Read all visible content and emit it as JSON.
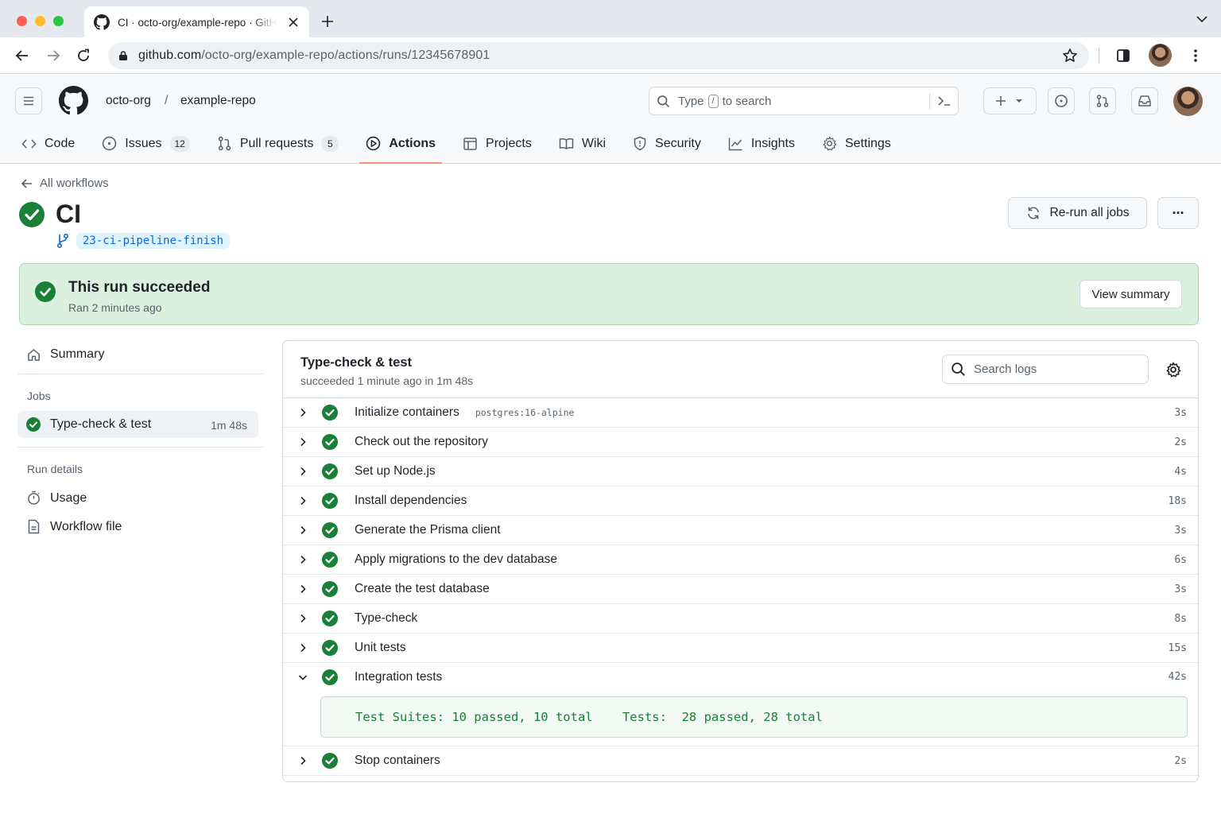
{
  "browser": {
    "tab_title": "CI · octo-org/example-repo · GitHub",
    "url_host": "github.com",
    "url_path": "/octo-org/example-repo/actions/runs/12345678901"
  },
  "header": {
    "owner": "octo-org",
    "separator": "/",
    "repo": "example-repo",
    "search": {
      "prefix": "Type",
      "key": "/",
      "suffix": "to search"
    }
  },
  "nav": [
    {
      "label": "Code",
      "count": null
    },
    {
      "label": "Issues",
      "count": "12"
    },
    {
      "label": "Pull requests",
      "count": "5"
    },
    {
      "label": "Actions",
      "count": null,
      "active": true
    },
    {
      "label": "Projects",
      "count": null
    },
    {
      "label": "Wiki",
      "count": null
    },
    {
      "label": "Security",
      "count": null
    },
    {
      "label": "Insights",
      "count": null
    },
    {
      "label": "Settings",
      "count": null
    }
  ],
  "run": {
    "back_label": "All workflows",
    "workflow_name": "CI",
    "branch": "23-ci-pipeline-finish",
    "rerun_label": "Re-run all jobs",
    "more_label": "···",
    "status_title": "This run succeeded",
    "status_sub": "Ran 2 minutes ago",
    "view_summary": "View summary"
  },
  "sidebar": {
    "summary": "Summary",
    "jobs_heading": "Jobs",
    "job": {
      "name": "Type-check & test",
      "duration": "1m 48s"
    },
    "details_heading": "Run details",
    "usage": "Usage",
    "workflow_file": "Workflow file"
  },
  "job": {
    "title": "Type-check & test",
    "subtitle": "succeeded  1 minute ago in 1m 48s",
    "search_placeholder": "Search logs",
    "steps": [
      {
        "name": "Initialize containers",
        "tag": "postgres:16-alpine",
        "duration": "3s"
      },
      {
        "name": "Check out the repository",
        "duration": "2s"
      },
      {
        "name": "Set up Node.js",
        "duration": "4s"
      },
      {
        "name": "Install dependencies",
        "duration": "18s"
      },
      {
        "name": "Generate the Prisma client",
        "duration": "3s"
      },
      {
        "name": "Apply migrations to the dev database",
        "duration": "6s"
      },
      {
        "name": "Create the test database",
        "duration": "3s"
      },
      {
        "name": "Type-check",
        "duration": "8s"
      },
      {
        "name": "Unit tests",
        "duration": "15s"
      },
      {
        "name": "Integration tests",
        "duration": "42s",
        "expanded": true
      },
      {
        "name": "Stop containers",
        "duration": "2s"
      }
    ],
    "log_line": "Test Suites: 10 passed, 10 total    Tests:  28 passed, 28 total"
  },
  "colors": {
    "success": "#1a7f37",
    "accent_underline": "#fd8c73",
    "link": "#0969da"
  }
}
